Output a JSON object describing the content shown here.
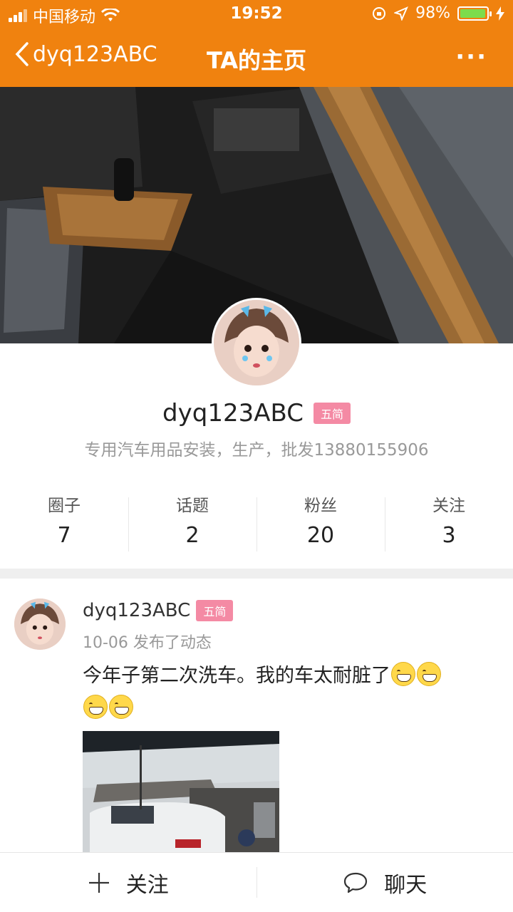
{
  "status_bar": {
    "carrier": "中国移动",
    "time": "19:52",
    "battery": "98%",
    "battery_level": 0.98
  },
  "nav": {
    "back_label": "dyq123ABC",
    "title": "TA的主页",
    "more_label": "···"
  },
  "profile": {
    "name": "dyq123ABC",
    "badge": "五简",
    "bio": "专用汽车用品安装，生产，批发13880155906"
  },
  "stats": [
    {
      "label": "圈子",
      "count": "7"
    },
    {
      "label": "话题",
      "count": "2"
    },
    {
      "label": "粉丝",
      "count": "20"
    },
    {
      "label": "关注",
      "count": "3"
    }
  ],
  "post": {
    "author": "dyq123ABC",
    "badge": "五简",
    "meta": "10-06 发布了动态",
    "text": "今年子第二次洗车。我的车太耐脏了",
    "emoji_count": 4
  },
  "bottom_bar": {
    "follow_label": "关注",
    "follow_icon": "plus-icon",
    "chat_label": "聊天",
    "chat_icon": "chat-bubble-icon"
  },
  "colors": {
    "header": "#f0820f",
    "badge": "#f48aa4",
    "battery_fill": "#7ddc4c"
  }
}
